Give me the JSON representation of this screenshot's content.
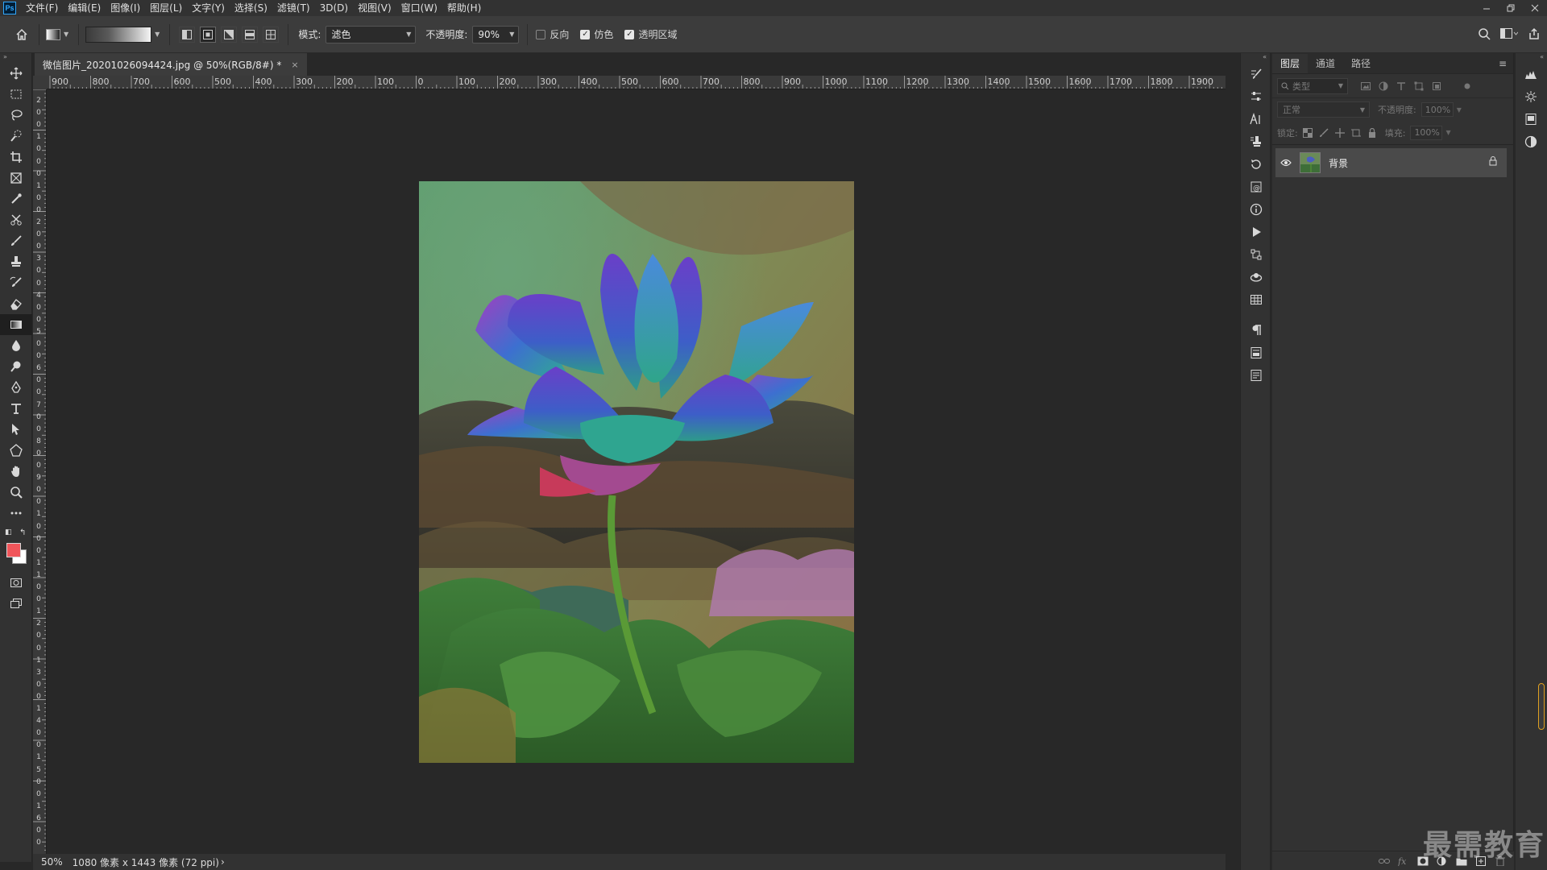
{
  "app": {
    "logo": "Ps"
  },
  "menu": [
    "文件(F)",
    "编辑(E)",
    "图像(I)",
    "图层(L)",
    "文字(Y)",
    "选择(S)",
    "滤镜(T)",
    "3D(D)",
    "视图(V)",
    "窗口(W)",
    "帮助(H)"
  ],
  "options": {
    "mode_label": "模式:",
    "mode_value": "滤色",
    "opacity_label": "不透明度:",
    "opacity_value": "90%",
    "reverse_label": "反向",
    "reverse_checked": false,
    "dither_label": "仿色",
    "dither_checked": true,
    "transparency_label": "透明区域",
    "transparency_checked": true
  },
  "colors": {
    "foreground": "#f0555a",
    "background": "#ffffff"
  },
  "document": {
    "tab_title": "微信图片_20201026094424.jpg @ 50%(RGB/8#) *",
    "close": "×"
  },
  "ruler_h": [
    "900",
    "800",
    "700",
    "600",
    "500",
    "400",
    "300",
    "200",
    "100",
    "0",
    "100",
    "200",
    "300",
    "400",
    "500",
    "600",
    "700",
    "800",
    "900",
    "1000",
    "1100",
    "1200",
    "1300",
    "1400",
    "1500",
    "1600",
    "1700",
    "1800",
    "1900"
  ],
  "ruler_v": [
    "2",
    "0",
    "0",
    "1",
    "0",
    "0",
    "0",
    "1",
    "0",
    "0",
    "2",
    "0",
    "0",
    "3",
    "0",
    "0",
    "4",
    "0",
    "0",
    "5",
    "0",
    "0",
    "6",
    "0",
    "0",
    "7",
    "0",
    "0",
    "8",
    "0",
    "0",
    "9",
    "0",
    "0",
    "1",
    "0",
    "0",
    "0",
    "1",
    "1",
    "0",
    "0",
    "1",
    "2",
    "0",
    "0",
    "1",
    "3",
    "0",
    "0",
    "1",
    "4",
    "0",
    "0",
    "1",
    "5",
    "0",
    "0",
    "1",
    "6",
    "0",
    "0"
  ],
  "status": {
    "zoom": "50%",
    "info": "1080 像素 x 1443 像素 (72 ppi)",
    "arrow": "›"
  },
  "layers": {
    "tabs": [
      "图层",
      "通道",
      "路径"
    ],
    "filter_placeholder": "类型",
    "blend_mode": "正常",
    "opacity_label": "不透明度:",
    "opacity_value": "100%",
    "lock_label": "锁定:",
    "fill_label": "填充:",
    "fill_value": "100%",
    "items": [
      {
        "name": "背景"
      }
    ]
  },
  "watermark": "最需教育",
  "accent_colors": {
    "panel": "#323232",
    "canvas": "#282828",
    "scroll_accent": "#e0a020"
  }
}
